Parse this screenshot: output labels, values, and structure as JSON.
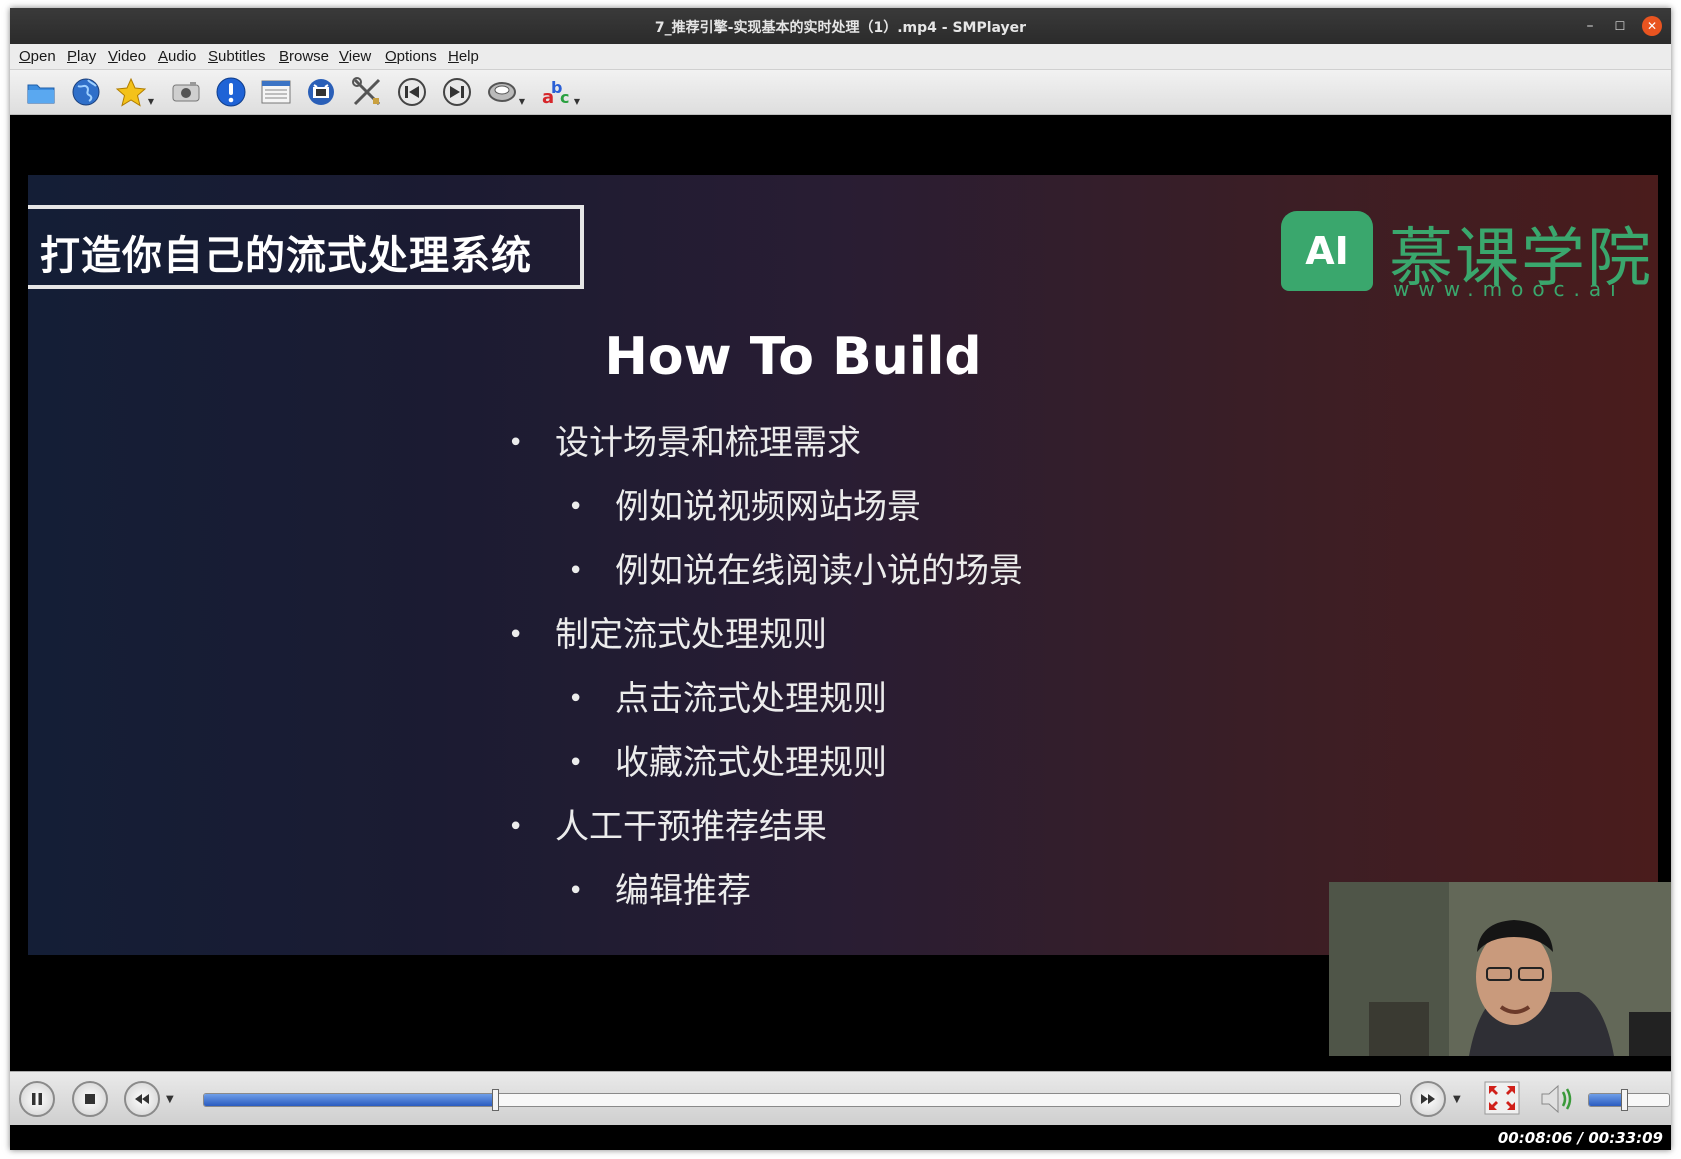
{
  "window": {
    "title": "7_推荐引擎-实现基本的实时处理（1）.mp4 - SMPlayer"
  },
  "menu": [
    {
      "label": "Open",
      "ul": "O",
      "rest": "pen"
    },
    {
      "label": "Play",
      "ul": "P",
      "rest": "lay"
    },
    {
      "label": "Video",
      "ul": "V",
      "rest": "ideo"
    },
    {
      "label": "Audio",
      "ul": "A",
      "rest": "udio"
    },
    {
      "label": "Subtitles",
      "ul": "S",
      "rest": "ubtitles"
    },
    {
      "label": "Browse",
      "ul": "B",
      "rest": "rowse"
    },
    {
      "label": "View",
      "ul": "V",
      "rest": "iew"
    },
    {
      "label": "Options",
      "ul": "O",
      "rest": "ptions"
    },
    {
      "label": "Help",
      "ul": "H",
      "rest": "elp"
    }
  ],
  "toolbar": [
    "open-folder-icon",
    "globe-icon",
    "favorites-star-icon",
    "screenshot-camera-icon",
    "info-icon",
    "playlist-icon",
    "video-equalizer-icon",
    "preferences-tools-icon",
    "previous-icon",
    "next-icon",
    "audio-track-icon",
    "subtitle-abc-icon"
  ],
  "slide": {
    "title_box": "打造你自己的流式处理系统",
    "logo_badge": "AI",
    "logo_name": "慕课学院",
    "logo_url": "www.mooc.ai",
    "heading": "How To Build",
    "bullets": [
      {
        "level": 1,
        "text": "设计场景和梳理需求"
      },
      {
        "level": 2,
        "text": "例如说视频网站场景"
      },
      {
        "level": 2,
        "text": "例如说在线阅读小说的场景"
      },
      {
        "level": 1,
        "text": "制定流式处理规则"
      },
      {
        "level": 2,
        "text": "点击流式处理规则"
      },
      {
        "level": 2,
        "text": "收藏流式处理规则"
      },
      {
        "level": 1,
        "text": "人工干预推荐结果"
      },
      {
        "level": 2,
        "text": "编辑推荐"
      }
    ],
    "bullet_mark": "•"
  },
  "playback": {
    "time_text": "00:08:06 / 00:33:09",
    "progress": 0.2443,
    "volume": 0.45
  },
  "colors": {
    "brand_green": "#3aa76d",
    "close_button": "#e95420",
    "seek_fill": "#2b5cc0"
  }
}
